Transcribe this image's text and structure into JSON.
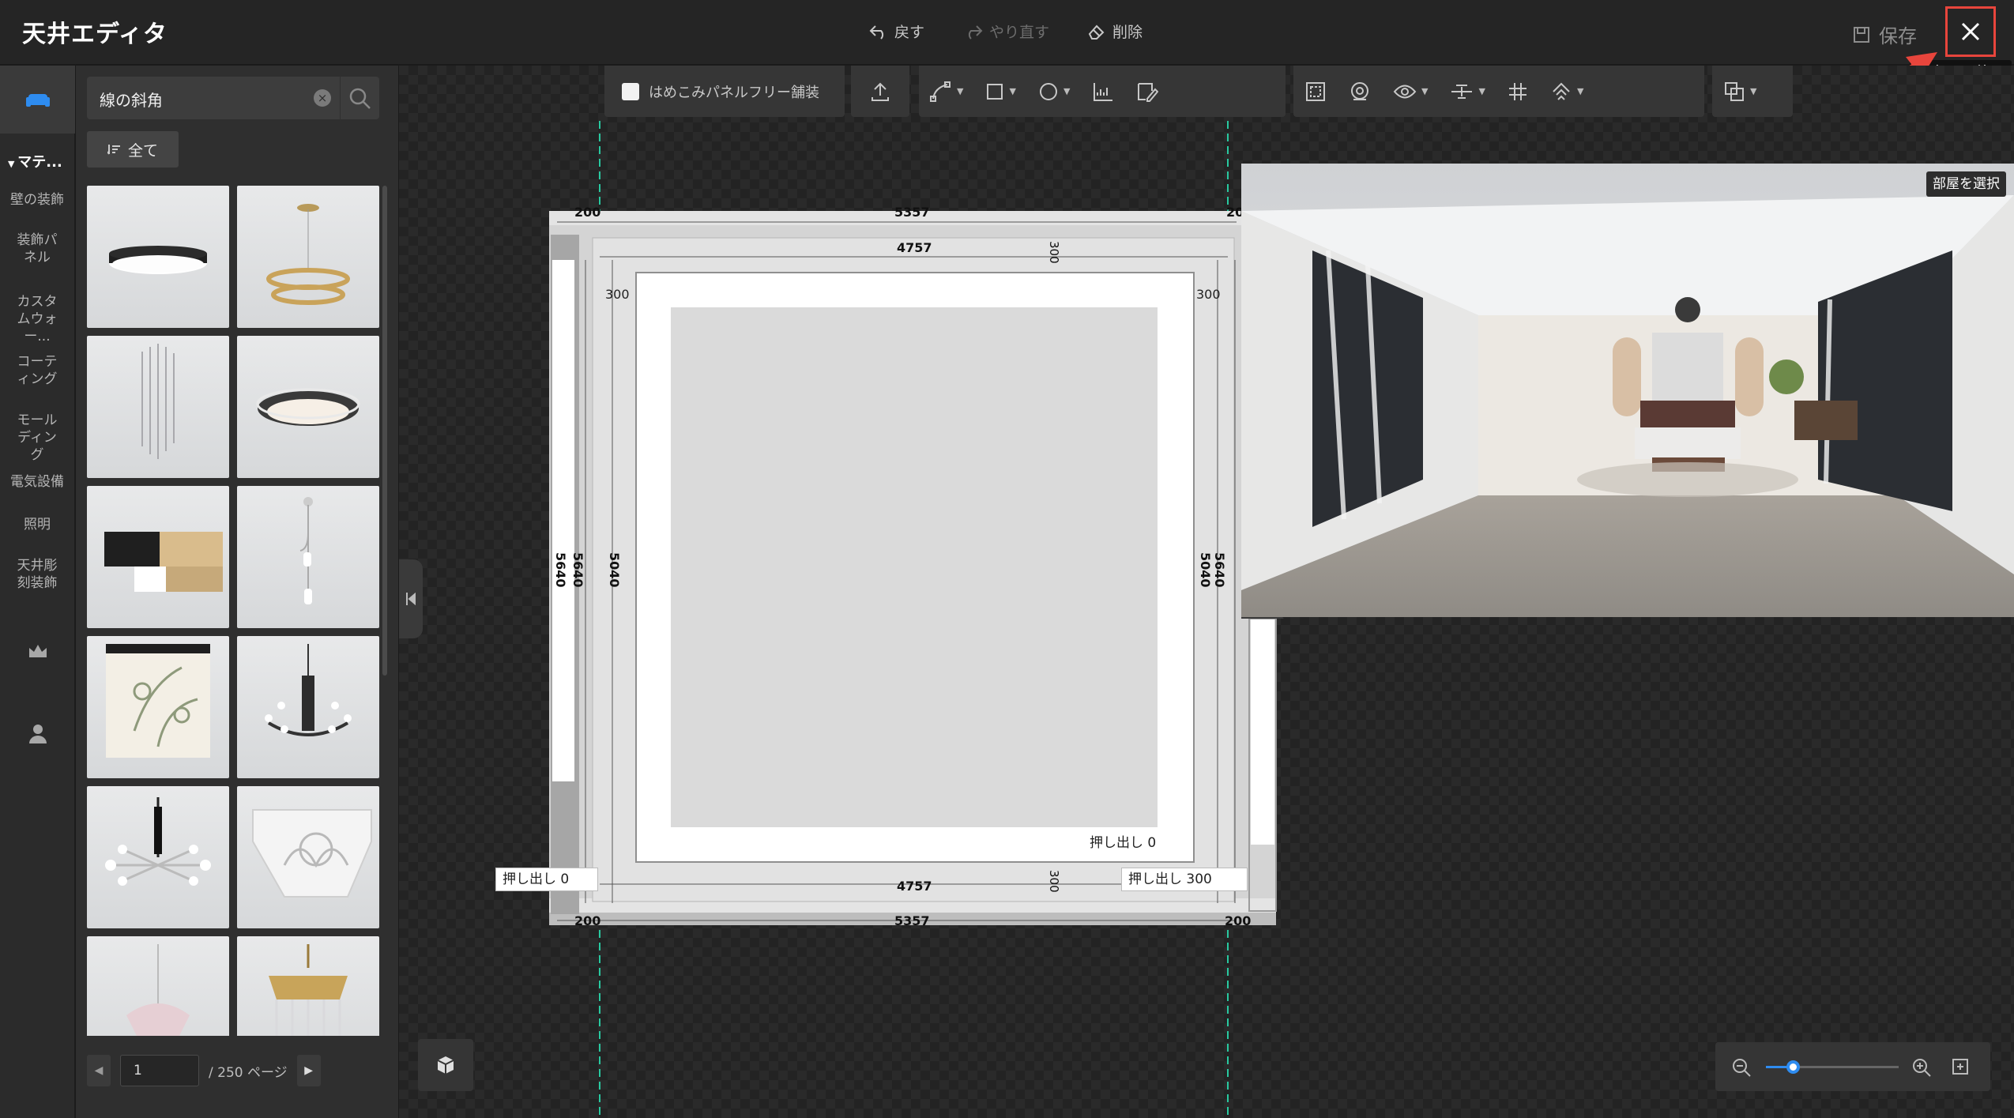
{
  "app": {
    "title": "天井エディタ"
  },
  "history": {
    "undo": "戻す",
    "redo": "やり直す",
    "delete": "削除"
  },
  "header": {
    "save": "保存",
    "close_tooltip": "保存して終了"
  },
  "rail": {
    "section": "マテ...",
    "items": [
      {
        "label": "壁の装飾"
      },
      {
        "label": "装飾パネル"
      },
      {
        "label": "カスタムウォー..."
      },
      {
        "label": "コーティング"
      },
      {
        "label": "モールディング"
      },
      {
        "label": "電気設備"
      },
      {
        "label": "照明"
      },
      {
        "label": "天井彫刻装飾"
      }
    ],
    "bottom_icons": [
      "crown-icon",
      "user-icon"
    ]
  },
  "catalog": {
    "search_value": "線の斜角",
    "filter_label": "全て",
    "items": [
      {
        "icon": "ceiling-light-round-black"
      },
      {
        "icon": "gold-ring-chandelier"
      },
      {
        "icon": "crystal-rain-chandelier"
      },
      {
        "icon": "oval-flush-light"
      },
      {
        "icon": "wood-block-light"
      },
      {
        "icon": "pendant-drop-light"
      },
      {
        "icon": "fabric-drum-light"
      },
      {
        "icon": "iron-chandelier"
      },
      {
        "icon": "sputnik-pendant"
      },
      {
        "icon": "carved-corbel"
      },
      {
        "icon": "crystal-pendant-pink"
      },
      {
        "icon": "gold-crystal-chandelier"
      }
    ],
    "page_current": "1",
    "page_total": "/ 250 ページ"
  },
  "toolbar": {
    "recess_checkbox": "はめこみパネルフリー舗装",
    "recess_checked": false,
    "tools": [
      "upload-icon",
      "path-tool-icon",
      "rectangle-tool-icon",
      "circle-tool-icon",
      "ruler-icon",
      "edit-icon",
      "select-area-icon",
      "lasso-icon",
      "eye-icon",
      "align-icon",
      "grid-icon",
      "magnet-icon",
      "layers-icon"
    ]
  },
  "plan": {
    "dims": {
      "outer_width_top": "5357",
      "outer_width_bottom": "5357",
      "inner_width_top": "4757",
      "inner_width_bottom": "4757",
      "margin_tl": "200",
      "margin_tr": "20",
      "margin_bl": "200",
      "margin_br": "200",
      "offset_top_v": "300",
      "offset_bottom_v": "300",
      "offset_left": "300",
      "offset_right": "300",
      "height_outer_left": "5640",
      "height_left": "5640",
      "height_inner": "5040",
      "height_right_1": "5040",
      "height_right_2": "5640"
    },
    "extrude_inner": "押し出し  0",
    "extrude_left": "押し出し  0",
    "extrude_right": "押し出し  300"
  },
  "preview": {
    "select_room": "部屋を選択"
  },
  "zoom": {
    "level": 0.2
  },
  "colors": {
    "accent": "#2e8cf0",
    "guide": "#28c9a0",
    "close_highlight": "#e8453c"
  }
}
